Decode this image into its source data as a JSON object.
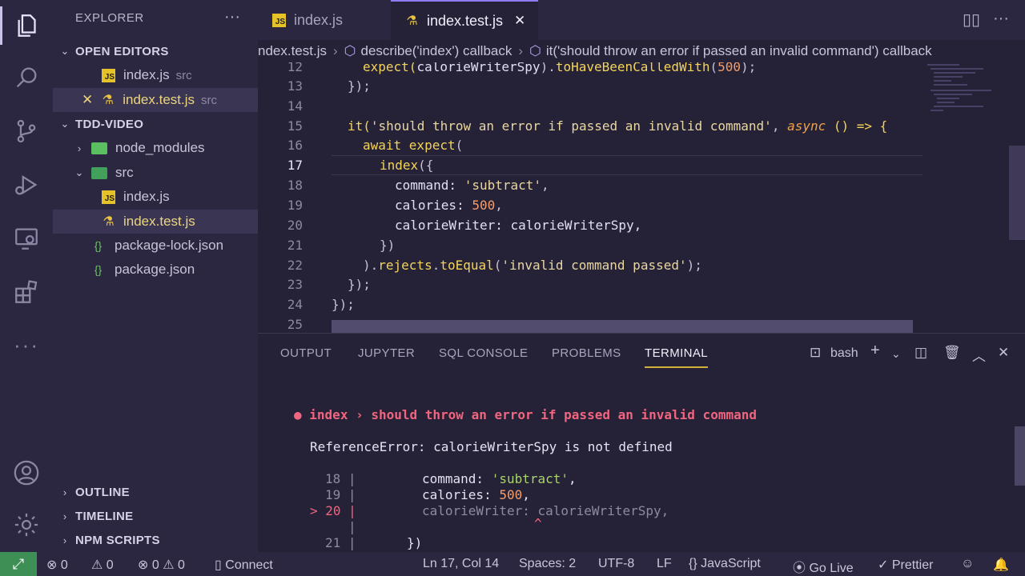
{
  "sidebar": {
    "title": "EXPLORER",
    "more": "···",
    "open_editors_label": "OPEN EDITORS",
    "open_editors": [
      {
        "name": "index.js",
        "dir": "src"
      },
      {
        "name": "index.test.js",
        "dir": "src"
      }
    ],
    "project_label": "TDD-VIDEO",
    "tree": {
      "node_modules": "node_modules",
      "src": "src",
      "src_index": "index.js",
      "src_test": "index.test.js",
      "lock": "package-lock.json",
      "pkg": "package.json"
    },
    "outline": "OUTLINE",
    "timeline": "TIMELINE",
    "npm": "NPM SCRIPTS"
  },
  "tabs": [
    {
      "label": "index.js"
    },
    {
      "label": "index.test.js"
    }
  ],
  "breadcrumb": {
    "file": "ndex.test.js",
    "describe": "describe('index') callback",
    "it": "it('should throw an error if passed an invalid command') callback"
  },
  "editor": {
    "lines": [
      {
        "n": "12"
      },
      {
        "n": "13"
      },
      {
        "n": "14"
      },
      {
        "n": "15"
      },
      {
        "n": "16"
      },
      {
        "n": "17"
      },
      {
        "n": "18"
      },
      {
        "n": "19"
      },
      {
        "n": "20"
      },
      {
        "n": "21"
      },
      {
        "n": "22"
      },
      {
        "n": "23"
      },
      {
        "n": "24"
      },
      {
        "n": "25"
      }
    ],
    "code": {
      "l12a": "expect(",
      "l12b": "calorieWriterSpy",
      "l12c": ").",
      "l12d": "toHaveBeenCalledWith",
      "l12e": "(",
      "l12f": "500",
      "l12g": ");",
      "l13": "});",
      "l15a": "it(",
      "l15b": "'should throw an error if passed an invalid command'",
      "l15c": ", ",
      "l15d": "async",
      "l15e": " () => {",
      "l16a": "await ",
      "l16b": "expect",
      "l16c": "(",
      "l17a": "index",
      "l17b": "({",
      "l18a": "command: ",
      "l18b": "'subtract'",
      "l18c": ",",
      "l19a": "calories: ",
      "l19b": "500",
      "l19c": ",",
      "l20a": "calorieWriter: calorieWriterSpy,",
      "l21": "})",
      "l22a": ").",
      "l22b": "rejects",
      "l22c": ".",
      "l22d": "toEqual",
      "l22e": "(",
      "l22f": "'invalid command passed'",
      "l22g": ");",
      "l23": "});",
      "l24": "});"
    }
  },
  "panel": {
    "tabs": [
      "OUTPUT",
      "JUPYTER",
      "SQL CONSOLE",
      "PROBLEMS",
      "TERMINAL"
    ],
    "shell": "bash",
    "terminal": {
      "bullet": "●",
      "title": "index › should throw an error if passed an invalid command",
      "error": "ReferenceError: calorieWriterSpy is not defined",
      "r18n": "18 |",
      "r18a": "command: ",
      "r18b": "'subtract'",
      "r18c": ",",
      "r19n": "19 |",
      "r19a": "calories: ",
      "r19b": "500",
      "r19c": ",",
      "r20m": "> 20 |",
      "r20a": "calorieWriter: calorieWriterSpy,",
      "rbar": "|",
      "caret": "^",
      "r21n": "21 |",
      "r21a": "})"
    }
  },
  "status": {
    "errors": "0",
    "warnings": "0",
    "info_a": "0",
    "info_b": "0",
    "connect": "Connect",
    "position": "Ln 17, Col 14",
    "spaces": "Spaces: 2",
    "encoding": "UTF-8",
    "eol": "LF",
    "language": "JavaScript",
    "golive": "Go Live",
    "prettier": "Prettier"
  },
  "colors": {
    "accent": "#8e7cf0",
    "remote": "#3d8f55",
    "error": "#f0657f"
  }
}
